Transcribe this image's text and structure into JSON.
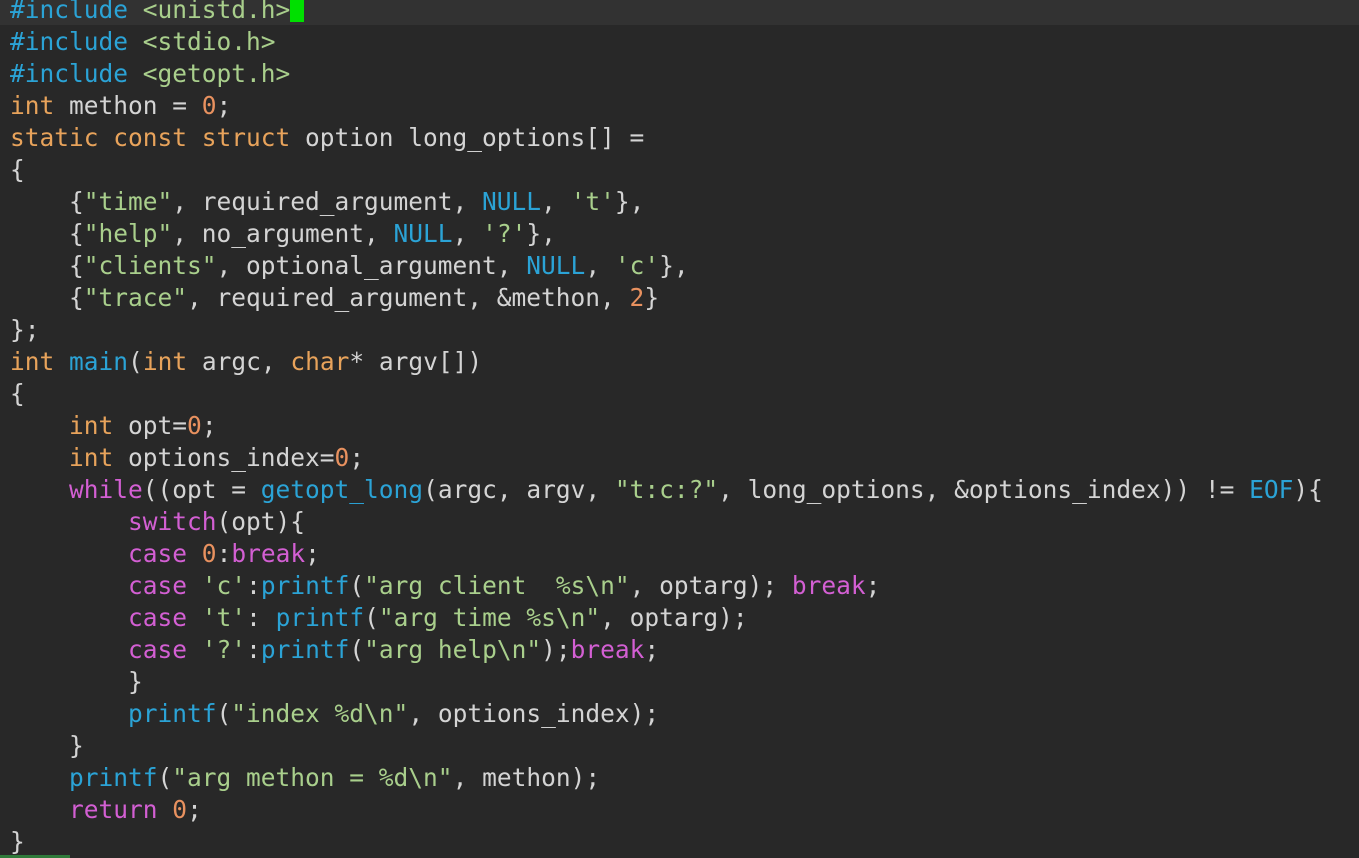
{
  "editor": {
    "lines": [
      [
        {
          "t": "#include ",
          "c": "pp"
        },
        {
          "t": "<unistd.h>",
          "c": "inc"
        },
        {
          "t": "",
          "c": "cursor"
        }
      ],
      [
        {
          "t": "#include ",
          "c": "pp"
        },
        {
          "t": "<stdio.h>",
          "c": "inc"
        }
      ],
      [
        {
          "t": "#include ",
          "c": "pp"
        },
        {
          "t": "<getopt.h>",
          "c": "inc"
        }
      ],
      [
        {
          "t": "int",
          "c": "ty"
        },
        {
          "t": " methon = ",
          "c": "txt"
        },
        {
          "t": "0",
          "c": "num"
        },
        {
          "t": ";",
          "c": "txt"
        }
      ],
      [
        {
          "t": "static const struct",
          "c": "ty"
        },
        {
          "t": " option long_options[] =",
          "c": "txt"
        }
      ],
      [
        {
          "t": "{",
          "c": "txt"
        }
      ],
      [
        {
          "t": "    {",
          "c": "txt"
        },
        {
          "t": "\"time\"",
          "c": "str"
        },
        {
          "t": ", required_argument, ",
          "c": "txt"
        },
        {
          "t": "NULL",
          "c": "fn"
        },
        {
          "t": ", ",
          "c": "txt"
        },
        {
          "t": "'t'",
          "c": "str"
        },
        {
          "t": "},",
          "c": "txt"
        }
      ],
      [
        {
          "t": "    {",
          "c": "txt"
        },
        {
          "t": "\"help\"",
          "c": "str"
        },
        {
          "t": ", no_argument, ",
          "c": "txt"
        },
        {
          "t": "NULL",
          "c": "fn"
        },
        {
          "t": ", ",
          "c": "txt"
        },
        {
          "t": "'?'",
          "c": "str"
        },
        {
          "t": "},",
          "c": "txt"
        }
      ],
      [
        {
          "t": "    {",
          "c": "txt"
        },
        {
          "t": "\"clients\"",
          "c": "str"
        },
        {
          "t": ", optional_argument, ",
          "c": "txt"
        },
        {
          "t": "NULL",
          "c": "fn"
        },
        {
          "t": ", ",
          "c": "txt"
        },
        {
          "t": "'c'",
          "c": "str"
        },
        {
          "t": "},",
          "c": "txt"
        }
      ],
      [
        {
          "t": "    {",
          "c": "txt"
        },
        {
          "t": "\"trace\"",
          "c": "str"
        },
        {
          "t": ", required_argument, &methon, ",
          "c": "txt"
        },
        {
          "t": "2",
          "c": "num"
        },
        {
          "t": "}",
          "c": "txt"
        }
      ],
      [
        {
          "t": "};",
          "c": "txt"
        }
      ],
      [
        {
          "t": "int",
          "c": "ty"
        },
        {
          "t": " ",
          "c": "txt"
        },
        {
          "t": "main",
          "c": "fn"
        },
        {
          "t": "(",
          "c": "txt"
        },
        {
          "t": "int",
          "c": "ty"
        },
        {
          "t": " argc, ",
          "c": "txt"
        },
        {
          "t": "char",
          "c": "ty"
        },
        {
          "t": "* argv[])",
          "c": "txt"
        }
      ],
      [
        {
          "t": "{",
          "c": "txt"
        }
      ],
      [
        {
          "t": "    ",
          "c": "txt"
        },
        {
          "t": "int",
          "c": "ty"
        },
        {
          "t": " opt=",
          "c": "txt"
        },
        {
          "t": "0",
          "c": "num"
        },
        {
          "t": ";",
          "c": "txt"
        }
      ],
      [
        {
          "t": "    ",
          "c": "txt"
        },
        {
          "t": "int",
          "c": "ty"
        },
        {
          "t": " options_index=",
          "c": "txt"
        },
        {
          "t": "0",
          "c": "num"
        },
        {
          "t": ";",
          "c": "txt"
        }
      ],
      [
        {
          "t": "    ",
          "c": "txt"
        },
        {
          "t": "while",
          "c": "kw"
        },
        {
          "t": "((opt = ",
          "c": "txt"
        },
        {
          "t": "getopt_long",
          "c": "fn"
        },
        {
          "t": "(argc, argv, ",
          "c": "txt"
        },
        {
          "t": "\"t:c:?\"",
          "c": "str"
        },
        {
          "t": ", long_options, &options_index)) != ",
          "c": "txt"
        },
        {
          "t": "EOF",
          "c": "fn"
        },
        {
          "t": "){",
          "c": "txt"
        }
      ],
      [
        {
          "t": "        ",
          "c": "txt"
        },
        {
          "t": "switch",
          "c": "kw"
        },
        {
          "t": "(opt){",
          "c": "txt"
        }
      ],
      [
        {
          "t": "        ",
          "c": "txt"
        },
        {
          "t": "case",
          "c": "kw"
        },
        {
          "t": " ",
          "c": "txt"
        },
        {
          "t": "0",
          "c": "num"
        },
        {
          "t": ":",
          "c": "txt"
        },
        {
          "t": "break",
          "c": "kw"
        },
        {
          "t": ";",
          "c": "txt"
        }
      ],
      [
        {
          "t": "        ",
          "c": "txt"
        },
        {
          "t": "case",
          "c": "kw"
        },
        {
          "t": " ",
          "c": "txt"
        },
        {
          "t": "'c'",
          "c": "str"
        },
        {
          "t": ":",
          "c": "txt"
        },
        {
          "t": "printf",
          "c": "fn"
        },
        {
          "t": "(",
          "c": "txt"
        },
        {
          "t": "\"arg client  %s\\n\"",
          "c": "str"
        },
        {
          "t": ", optarg); ",
          "c": "txt"
        },
        {
          "t": "break",
          "c": "kw"
        },
        {
          "t": ";",
          "c": "txt"
        }
      ],
      [
        {
          "t": "        ",
          "c": "txt"
        },
        {
          "t": "case",
          "c": "kw"
        },
        {
          "t": " ",
          "c": "txt"
        },
        {
          "t": "'t'",
          "c": "str"
        },
        {
          "t": ": ",
          "c": "txt"
        },
        {
          "t": "printf",
          "c": "fn"
        },
        {
          "t": "(",
          "c": "txt"
        },
        {
          "t": "\"arg time %s\\n\"",
          "c": "str"
        },
        {
          "t": ", optarg);",
          "c": "txt"
        }
      ],
      [
        {
          "t": "        ",
          "c": "txt"
        },
        {
          "t": "case",
          "c": "kw"
        },
        {
          "t": " ",
          "c": "txt"
        },
        {
          "t": "'?'",
          "c": "str"
        },
        {
          "t": ":",
          "c": "txt"
        },
        {
          "t": "printf",
          "c": "fn"
        },
        {
          "t": "(",
          "c": "txt"
        },
        {
          "t": "\"arg help\\n\"",
          "c": "str"
        },
        {
          "t": ");",
          "c": "txt"
        },
        {
          "t": "break",
          "c": "kw"
        },
        {
          "t": ";",
          "c": "txt"
        }
      ],
      [
        {
          "t": "        }",
          "c": "txt"
        }
      ],
      [
        {
          "t": "        ",
          "c": "txt"
        },
        {
          "t": "printf",
          "c": "fn"
        },
        {
          "t": "(",
          "c": "txt"
        },
        {
          "t": "\"index %d\\n\"",
          "c": "str"
        },
        {
          "t": ", options_index);",
          "c": "txt"
        }
      ],
      [
        {
          "t": "    }",
          "c": "txt"
        }
      ],
      [
        {
          "t": "    ",
          "c": "txt"
        },
        {
          "t": "printf",
          "c": "fn"
        },
        {
          "t": "(",
          "c": "txt"
        },
        {
          "t": "\"arg methon = %d\\n\"",
          "c": "str"
        },
        {
          "t": ", methon);",
          "c": "txt"
        }
      ],
      [
        {
          "t": "    ",
          "c": "txt"
        },
        {
          "t": "return",
          "c": "kw"
        },
        {
          "t": " ",
          "c": "txt"
        },
        {
          "t": "0",
          "c": "num"
        },
        {
          "t": ";",
          "c": "txt"
        }
      ],
      [
        {
          "t": "}",
          "c": "txt"
        }
      ]
    ]
  },
  "colors": {
    "background": "#282828",
    "cursor": "#00e000",
    "preprocessor": "#2ba3d6",
    "include_path": "#a9cf8c",
    "type": "#e8a35b",
    "number": "#e8915f",
    "string": "#a9cf8c",
    "keyword": "#d35fd3",
    "function": "#2ba3d6",
    "text": "#d4d4d4"
  }
}
